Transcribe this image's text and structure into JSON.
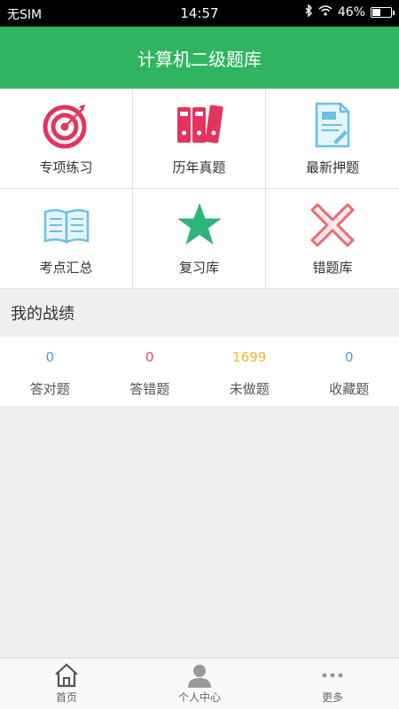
{
  "status": {
    "carrier": "无SIM",
    "time": "14:57",
    "battery": "46%",
    "battery_level": 0.46
  },
  "header": {
    "title": "计算机二级题库"
  },
  "menu": {
    "items": [
      {
        "label": "专项练习",
        "icon": "target-icon"
      },
      {
        "label": "历年真题",
        "icon": "binders-icon"
      },
      {
        "label": "最新押题",
        "icon": "document-edit-icon"
      },
      {
        "label": "考点汇总",
        "icon": "open-book-icon"
      },
      {
        "label": "复习库",
        "icon": "star-icon"
      },
      {
        "label": "错题库",
        "icon": "x-mark-icon"
      }
    ]
  },
  "record": {
    "title": "我的战绩",
    "stats": [
      {
        "value": "0",
        "label": "答对题",
        "color": "#4aa3d8"
      },
      {
        "value": "0",
        "label": "答错题",
        "color": "#e8476b"
      },
      {
        "value": "1699",
        "label": "未做题",
        "color": "#f3b72b"
      },
      {
        "value": "0",
        "label": "收藏题",
        "color": "#4aa3d8"
      }
    ]
  },
  "tabbar": {
    "tabs": [
      {
        "label": "首页",
        "icon": "home-icon"
      },
      {
        "label": "个人中心",
        "icon": "person-icon"
      },
      {
        "label": "更多",
        "icon": "more-dots-icon"
      }
    ]
  },
  "colors": {
    "brand_green": "#2fb561",
    "accent_red": "#e4335f",
    "accent_blue": "#6cc0e5"
  }
}
